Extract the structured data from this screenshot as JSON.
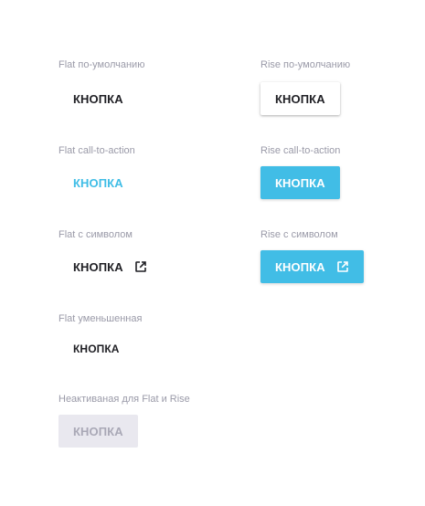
{
  "flat_default": {
    "caption": "Flat по-умолчанию",
    "label": "КНОПКА"
  },
  "rise_default": {
    "caption": "Rise по-умолчанию",
    "label": "КНОПКА"
  },
  "flat_cta": {
    "caption": "Flat call-to-action",
    "label": "КНОПКА"
  },
  "rise_cta": {
    "caption": "Rise call-to-action",
    "label": "КНОПКА"
  },
  "flat_icon": {
    "caption": "Flat с символом",
    "label": "КНОПКА",
    "icon": "external-link-icon"
  },
  "rise_icon": {
    "caption": "Rise с символом",
    "label": "КНОПКА",
    "icon": "external-link-icon"
  },
  "flat_small": {
    "caption": "Flat уменьшенная",
    "label": "КНОПКА"
  },
  "disabled": {
    "caption": "Неактиваная для Flat и Rise",
    "label": "КНОПКА"
  },
  "colors": {
    "accent": "#41bde6",
    "text": "#1f1f24",
    "caption": "#9a9aa8",
    "disabled_bg": "#e9e8ef",
    "disabled_text": "#a9a8b6"
  }
}
